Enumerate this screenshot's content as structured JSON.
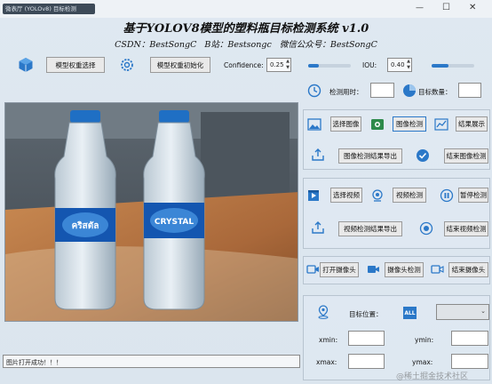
{
  "window": {
    "title": "微表厅 (YOLOv8) 目标检测",
    "controls": {
      "minimize": "—",
      "maximize": "☐",
      "close": "✕"
    }
  },
  "header": {
    "title": "基于YOLOV8模型的塑料瓶目标检测系统 v1.0",
    "subtitle": "CSDN：BestSongC   B站：Bestsongc   微信公众号：BestSongC"
  },
  "toolbar": {
    "model_select": "模型权重选择",
    "model_init": "模型权重初始化",
    "confidence_label": "Confidence:",
    "confidence_value": "0.25",
    "confidence_level": 0.25,
    "iou_label": "IOU:",
    "iou_value": "0.40",
    "iou_level": 0.4
  },
  "stats": {
    "time_label": "检测用时：",
    "time_value": "",
    "count_label": "目标数量：",
    "count_value": ""
  },
  "image_section": {
    "select": "选择图像",
    "detect": "图像检测",
    "show": "结果展示",
    "export": "图像检测结果导出",
    "stop": "结束图像检测"
  },
  "video_section": {
    "select": "选择视频",
    "detect": "视频检测",
    "pause": "暂停检测",
    "export": "视频检测结果导出",
    "stop": "结束视频检测"
  },
  "camera_section": {
    "open": "打开摄像头",
    "detect": "摄像头检测",
    "stop": "结束摄像头"
  },
  "target": {
    "label": "目标位置：",
    "all": "ALL",
    "select_value": "",
    "xmin_label": "xmin:",
    "ymin_label": "ymin:",
    "xmax_label": "xmax:",
    "ymax_label": "ymax:"
  },
  "preview": {
    "bottle_left_label": "คริสตัล",
    "bottle_right_label": "CRYSTAL"
  },
  "status": "图片打开成功！！！",
  "watermark": "@稀土掘金技术社区",
  "colors": {
    "accent_blue": "#2b78c8",
    "cap_blue": "#1f6fc4",
    "label_blue": "#1456b0"
  }
}
